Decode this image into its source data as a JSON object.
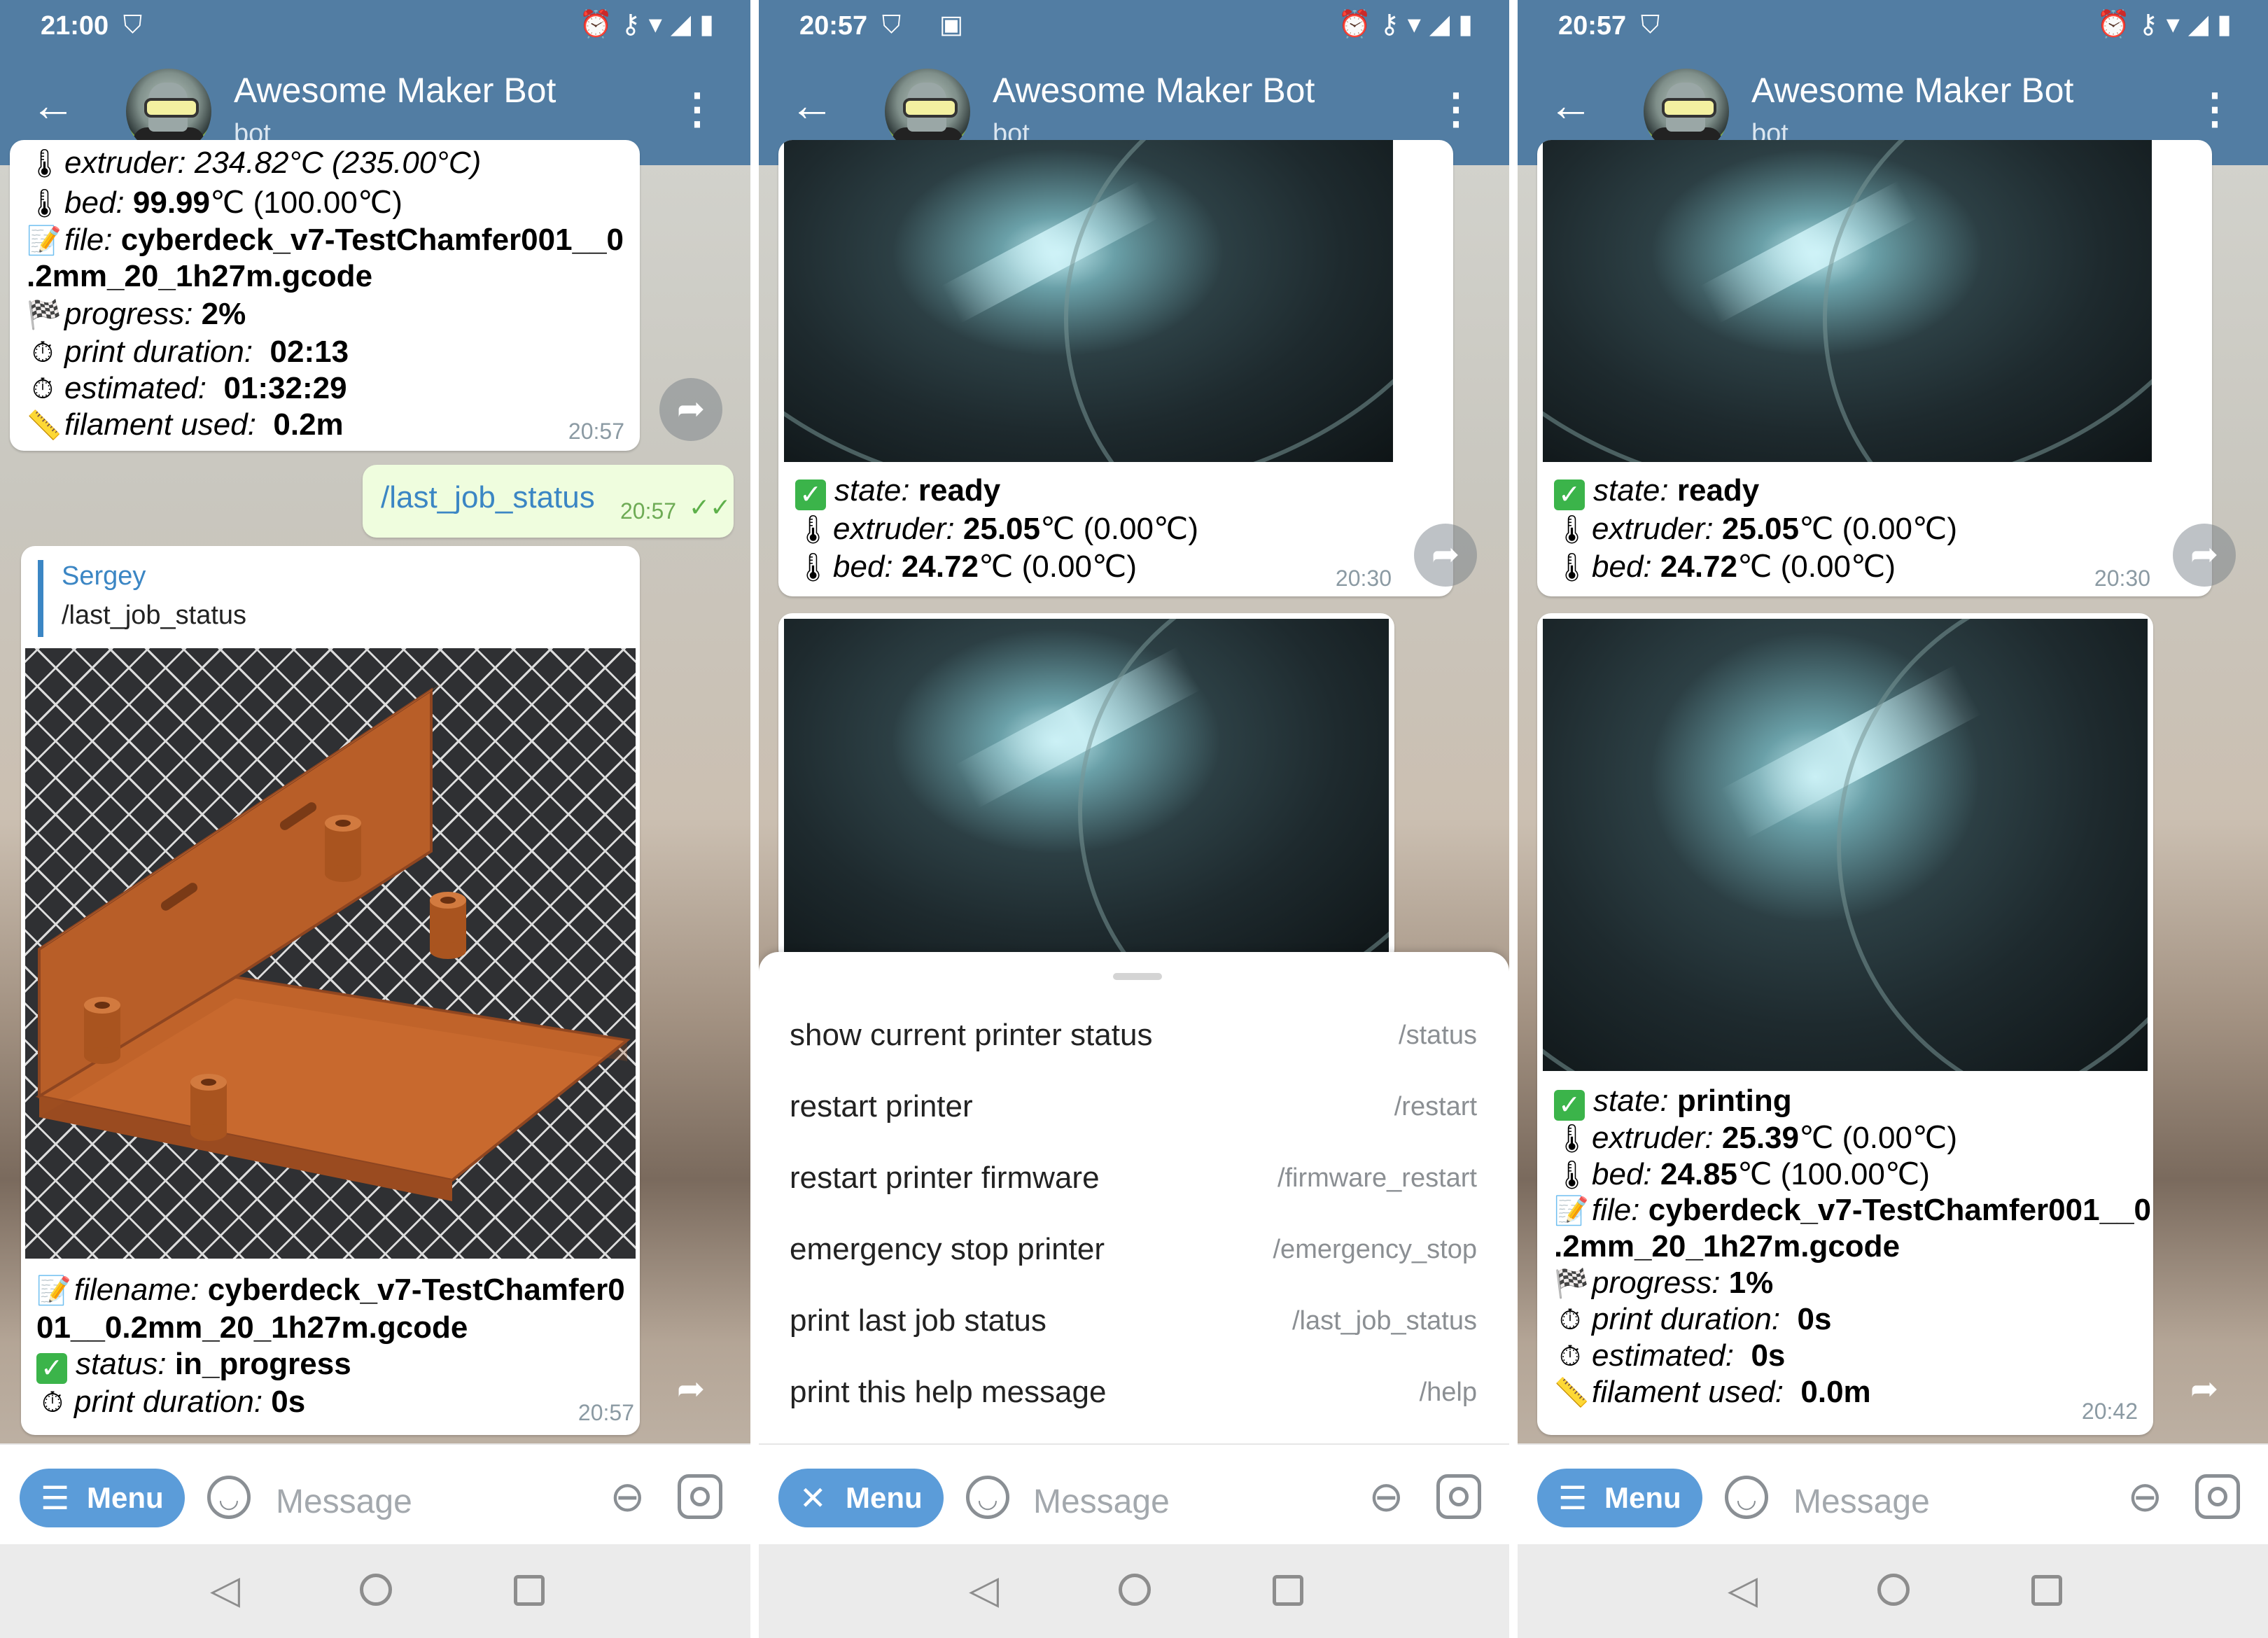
{
  "chat": {
    "title": "Awesome Maker Bot",
    "subtitle": "bot",
    "placeholder": "Message",
    "menu_label": "Menu",
    "menu_icon": "hamburger-icon",
    "menu_open_icon": "close-icon"
  },
  "panels": [
    {
      "time": "21:00",
      "status_msg": {
        "top_partial": "extruder: 234.82°C (235.00°C)",
        "bed_label": "bed:",
        "bed_value": "99.99",
        "bed_unit": "℃ (100.00℃)",
        "file_label": "file:",
        "file_line1": "cyberdeck_v7-TestChamfer001__0",
        "file_line2": ".2mm_20_1h27m.gcode",
        "progress_label": "progress:",
        "progress_value": "2%",
        "duration_label": "print duration:",
        "duration_value": "02:13",
        "estimated_label": "estimated:",
        "estimated_value": "01:32:29",
        "filament_label": "filament used:",
        "filament_value": "0.2m",
        "time": "20:57"
      },
      "outgoing": {
        "text": "/last_job_status",
        "time": "20:57"
      },
      "job_reply": {
        "reply_name": "Sergey",
        "reply_text": "/last_job_status",
        "filename_label": "filename:",
        "filename_line1": "cyberdeck_v7-TestChamfer0",
        "filename_line2": "01__0.2mm_20_1h27m.gcode",
        "status_label": "status:",
        "status_value": "in_progress",
        "duration_label": "print duration:",
        "duration_value": "0s",
        "time": "20:57"
      }
    },
    {
      "time": "20:57",
      "state_msg": {
        "state_label": "state:",
        "state_value": "ready",
        "extruder_label": "extruder:",
        "extruder_value": "25.05",
        "extruder_unit": "℃ (0.00℃)",
        "bed_label": "bed:",
        "bed_value": "24.72",
        "bed_unit": "℃ (0.00℃)",
        "time": "20:30"
      },
      "commands": [
        {
          "desc": "show current printer status",
          "cmd": "/status"
        },
        {
          "desc": "restart printer",
          "cmd": "/restart"
        },
        {
          "desc": "restart printer firmware",
          "cmd": "/firmware_restart"
        },
        {
          "desc": "emergency stop printer",
          "cmd": "/emergency_stop"
        },
        {
          "desc": "print last job status",
          "cmd": "/last_job_status"
        },
        {
          "desc": "print this help message",
          "cmd": "/help"
        }
      ]
    },
    {
      "time": "20:57",
      "state_msg": {
        "state_label": "state:",
        "state_value": "ready",
        "extruder_label": "extruder:",
        "extruder_value": "25.05",
        "extruder_unit": "℃ (0.00℃)",
        "bed_label": "bed:",
        "bed_value": "24.72",
        "bed_unit": "℃ (0.00℃)",
        "time": "20:30"
      },
      "print_msg": {
        "state_label": "state:",
        "state_value": "printing",
        "extruder_label": "extruder:",
        "extruder_value": "25.39",
        "extruder_unit": "℃ (0.00℃)",
        "bed_label": "bed:",
        "bed_value": "24.85",
        "bed_unit": "℃ (100.00℃)",
        "file_label": "file:",
        "file_line1": "cyberdeck_v7-TestChamfer001__0",
        "file_line2": ".2mm_20_1h27m.gcode",
        "progress_label": "progress:",
        "progress_value": "1%",
        "duration_label": "print duration:",
        "duration_value": "0s",
        "estimated_label": "estimated:",
        "estimated_value": "0s",
        "filament_label": "filament used:",
        "filament_value": "0.0m",
        "time": "20:42"
      }
    }
  ],
  "colors": {
    "header": "#527da3",
    "menu_button": "#5b9cd9",
    "outgoing_bg": "#effdde",
    "check": "#3bb44a",
    "model_orange": "#c8692e"
  }
}
